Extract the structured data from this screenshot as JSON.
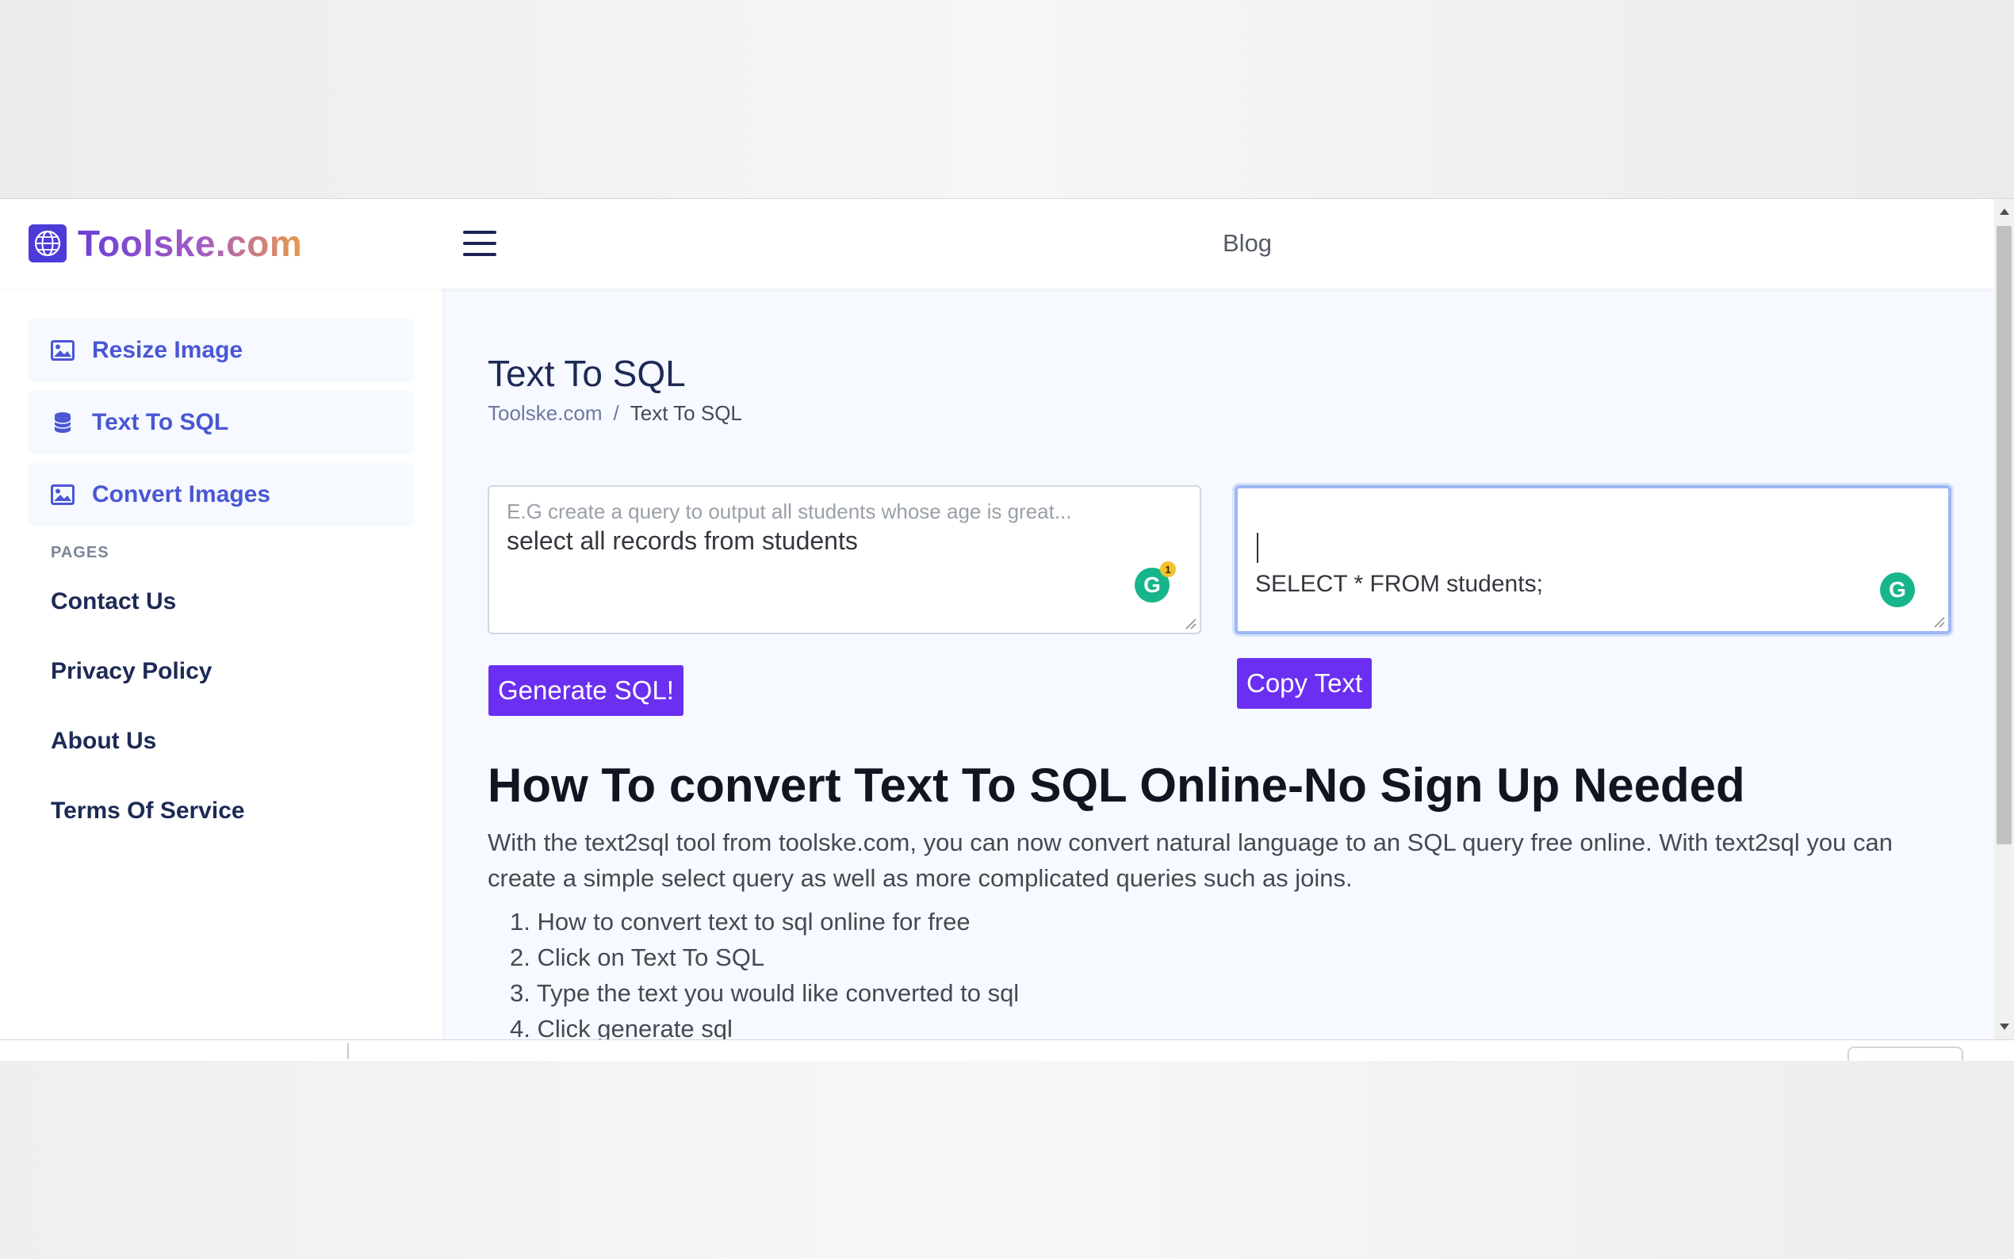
{
  "header": {
    "logo_text": "Toolske.com",
    "nav_blog": "Blog"
  },
  "sidebar": {
    "tools": [
      {
        "label": "Resize Image",
        "icon": "image-icon"
      },
      {
        "label": "Text To SQL",
        "icon": "database-icon"
      },
      {
        "label": "Convert Images",
        "icon": "image-icon"
      }
    ],
    "pages_heading": "PAGES",
    "pages": [
      {
        "label": "Contact Us"
      },
      {
        "label": "Privacy Policy"
      },
      {
        "label": "About Us"
      },
      {
        "label": "Terms Of Service"
      }
    ]
  },
  "main": {
    "title": "Text To SQL",
    "breadcrumb": {
      "home": "Toolske.com",
      "separator": "/",
      "current": "Text To SQL"
    },
    "input": {
      "placeholder": "E.G create a query to output all students whose age is great...",
      "value": "select all records from students",
      "grammarly_badge": "1"
    },
    "output": {
      "value": "SELECT * FROM students;"
    },
    "generate_button": "Generate SQL!",
    "copy_button": "Copy Text",
    "howto": {
      "title": "How To convert Text To SQL Online-No Sign Up Needed",
      "paragraph": "With the text2sql tool from toolske.com, you can now convert natural language to an SQL query free online. With text2sql you can create a simple select query as well as more complicated queries such as joins.",
      "steps": [
        "1. How to convert text to sql online for free",
        "2. Click on Text To SQL",
        "3. Type the text you would like converted to sql",
        "4. Click generate sql"
      ]
    }
  },
  "colors": {
    "accent": "#6a2ff0",
    "sidebar_link": "#4a57d4",
    "grammarly": "#17b58b"
  }
}
